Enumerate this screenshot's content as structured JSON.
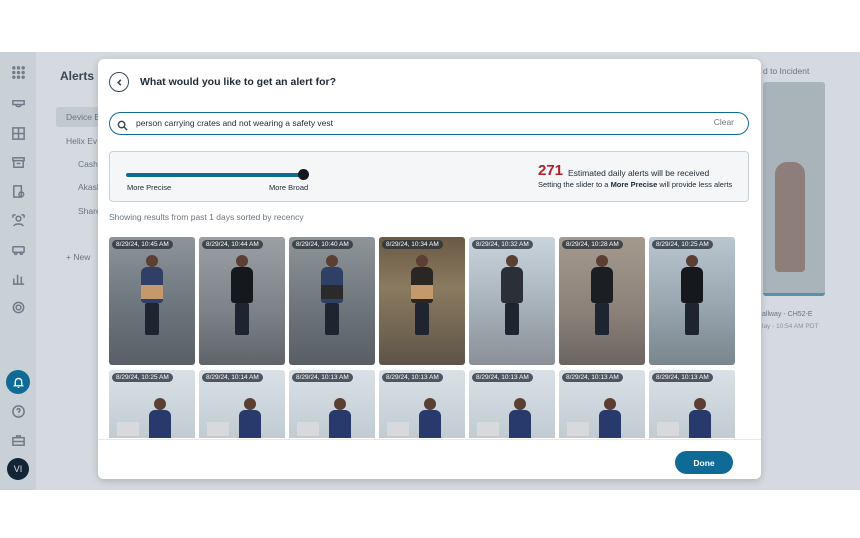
{
  "background": {
    "page_title": "Alerts",
    "nav_items": [
      "Device E",
      "Helix Ev",
      "Cash",
      "Akash",
      "Share"
    ],
    "new_label": "+ New",
    "right_title": "d to Incident",
    "camera_name": "allway - CH52-E",
    "camera_time": "lay - 10:54 AM PDT"
  },
  "modal": {
    "title": "What would you like to get an alert for?",
    "search": {
      "value": "person carrying crates and not wearing a safety vest",
      "clear_label": "Clear"
    },
    "precision": {
      "left_label": "More Precise",
      "right_label": "More Broad",
      "slider_value_fraction": 1.0,
      "estimate_count": "271",
      "estimate_label": "Estimated daily alerts will be received",
      "hint_prefix": "Setting the slider to a",
      "hint_bold": "More Precise",
      "hint_suffix": "will provide less alerts"
    },
    "results_label": "Showing results from past 1 days sorted by recency",
    "thumbnails": [
      {
        "timestamp": "8/29/24, 10:45 AM"
      },
      {
        "timestamp": "8/29/24, 10:44 AM"
      },
      {
        "timestamp": "8/29/24, 10:40 AM"
      },
      {
        "timestamp": "8/29/24, 10:34 AM"
      },
      {
        "timestamp": "8/29/24, 10:32 AM"
      },
      {
        "timestamp": "8/29/24, 10:28 AM"
      },
      {
        "timestamp": "8/29/24, 10:25 AM"
      },
      {
        "timestamp": "8/29/24, 10:25 AM"
      },
      {
        "timestamp": "8/29/24, 10:14 AM"
      },
      {
        "timestamp": "8/29/24, 10:13 AM"
      },
      {
        "timestamp": "8/29/24, 10:13 AM"
      },
      {
        "timestamp": "8/29/24, 10:13 AM"
      },
      {
        "timestamp": "8/29/24, 10:13 AM"
      },
      {
        "timestamp": "8/29/24, 10:13 AM"
      }
    ],
    "done_label": "Done"
  },
  "colors": {
    "accent": "#0f6b96",
    "count_red": "#b3202a",
    "overlay": "#d4dadf"
  },
  "icons": [
    "grid-icon",
    "camera-icon",
    "layout-icon",
    "archive-icon",
    "device-icon",
    "person-icon",
    "vehicle-icon",
    "chart-icon",
    "gear-icon",
    "bell-icon",
    "help-icon",
    "toolbox-icon",
    "back-arrow-icon",
    "search-icon"
  ],
  "avatar_initials": "VI"
}
